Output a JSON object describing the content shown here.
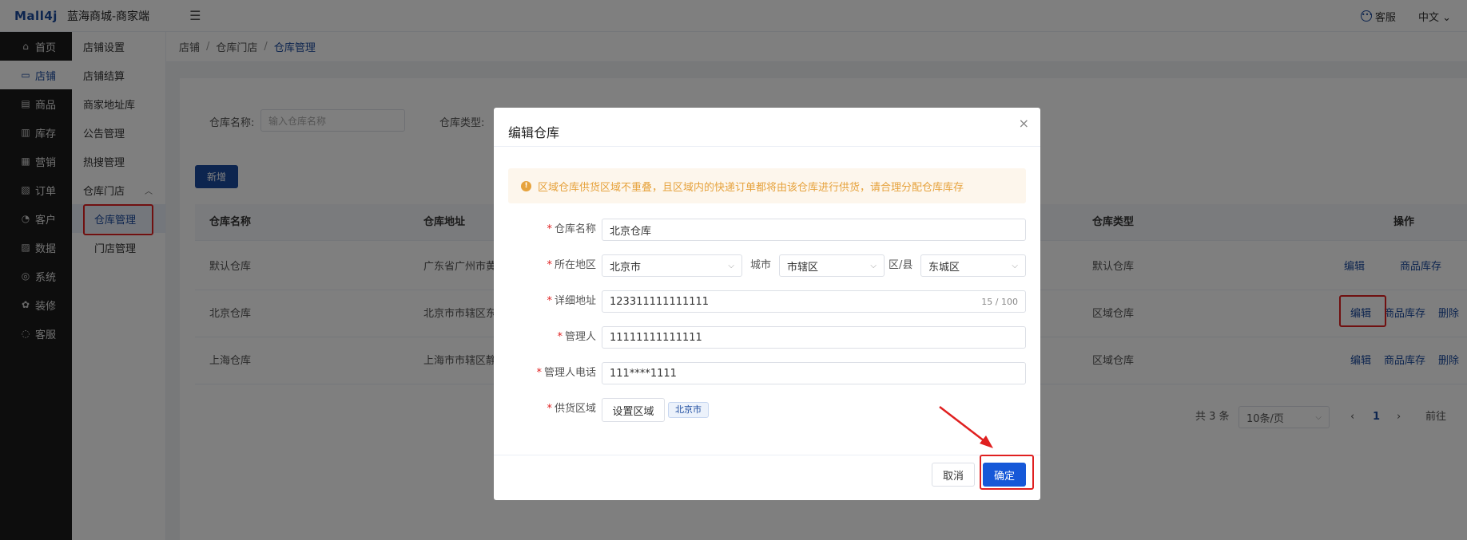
{
  "header": {
    "logo": "Mall4j",
    "shop_name": "蓝海商城-商家端",
    "service_label": "客服",
    "language_label": "中文",
    "language_chevron": "⌄"
  },
  "primary_nav": [
    {
      "label": "首页",
      "icon": "⌂"
    },
    {
      "label": "店铺",
      "icon": "▭"
    },
    {
      "label": "商品",
      "icon": "▤"
    },
    {
      "label": "库存",
      "icon": "▥"
    },
    {
      "label": "营销",
      "icon": "▦"
    },
    {
      "label": "订单",
      "icon": "▧"
    },
    {
      "label": "客户",
      "icon": "◔"
    },
    {
      "label": "数据",
      "icon": "▨"
    },
    {
      "label": "系统",
      "icon": "◎"
    },
    {
      "label": "装修",
      "icon": "✿"
    },
    {
      "label": "客服",
      "icon": "◌"
    }
  ],
  "secondary_nav": {
    "items": [
      "店铺设置",
      "店铺结算",
      "商家地址库",
      "公告管理",
      "热搜管理"
    ],
    "group_label": "仓库门店",
    "group_arrow": "︿",
    "group_children": [
      "仓库管理",
      "门店管理"
    ]
  },
  "breadcrumb": [
    "店铺",
    "仓库门店",
    "仓库管理"
  ],
  "breadcrumb_sep": "/",
  "search": {
    "name_label": "仓库名称:",
    "name_placeholder": "输入仓库名称",
    "type_label": "仓库类型:"
  },
  "toolbar": {
    "new_label": "新增"
  },
  "table": {
    "headers": {
      "name": "仓库名称",
      "address": "仓库地址",
      "type": "仓库类型",
      "ops": "操作"
    },
    "rows": [
      {
        "name": "默认仓库",
        "address": "广东省广州市黄",
        "type": "默认仓库",
        "ops": [
          "编辑",
          "商品库存"
        ]
      },
      {
        "name": "北京仓库",
        "address": "北京市市辖区东",
        "type": "区域仓库",
        "ops": [
          "编辑",
          "商品库存",
          "删除"
        ]
      },
      {
        "name": "上海仓库",
        "address": "上海市市辖区静",
        "type": "区域仓库",
        "ops": [
          "编辑",
          "商品库存",
          "删除"
        ]
      }
    ]
  },
  "pagination": {
    "total_label": "共 3 条",
    "page_size": "10条/页",
    "prev": "‹",
    "current_page": "1",
    "next": "›",
    "goto_label": "前往"
  },
  "dialog": {
    "title": "编辑仓库",
    "close_glyph": "×",
    "alert_icon": "!",
    "alert": "区域仓库供货区域不重叠，且区域内的快递订单都将由该仓库进行供货，请合理分配仓库库存",
    "required_mark": "*",
    "name_label": "仓库名称",
    "name_value": "北京仓库",
    "region_label": "所在地区",
    "province_value": "北京市",
    "city_label": "城市",
    "city_value": "市辖区",
    "district_label": "区/县",
    "district_value": "东城区",
    "address_label": "详细地址",
    "address_value": "123311111111111",
    "address_count": "15 / 100",
    "manager_label": "管理人",
    "manager_value": "11111111111111",
    "phone_label": "管理人电话",
    "phone_value": "111****1111",
    "area_label": "供货区域",
    "set_area_button": "设置区域",
    "area_tag": "北京市",
    "cancel_label": "取消",
    "confirm_label": "确定",
    "select_chevron": "⌵"
  },
  "colors": {
    "brand": "#1b4a9e",
    "primary_button": "#1658d8",
    "annotation": "#e02020",
    "warning": "#e6a23c"
  }
}
